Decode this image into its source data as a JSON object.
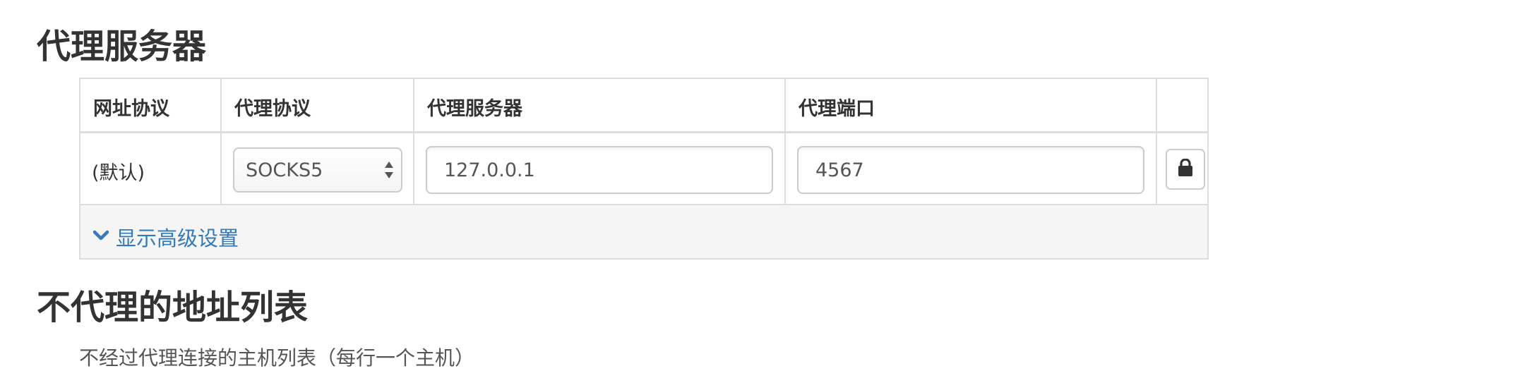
{
  "sections": {
    "proxy_server_title": "代理服务器",
    "bypass_list_title": "不代理的地址列表",
    "bypass_list_description": "不经过代理连接的主机列表（每行一个主机）"
  },
  "table": {
    "headers": [
      "网址协议",
      "代理协议",
      "代理服务器",
      "代理端口"
    ],
    "row": {
      "url_scheme": "(默认)",
      "protocol": "SOCKS5",
      "server": "127.0.0.1",
      "port": "4567",
      "lock_icon": "lock-icon"
    },
    "advanced_link": "显示高级设置",
    "advanced_icon": "chevron-down-icon"
  },
  "colors": {
    "link": "#337ab7",
    "border": "#dddddd",
    "advanced_row_bg": "#f5f5f5"
  }
}
